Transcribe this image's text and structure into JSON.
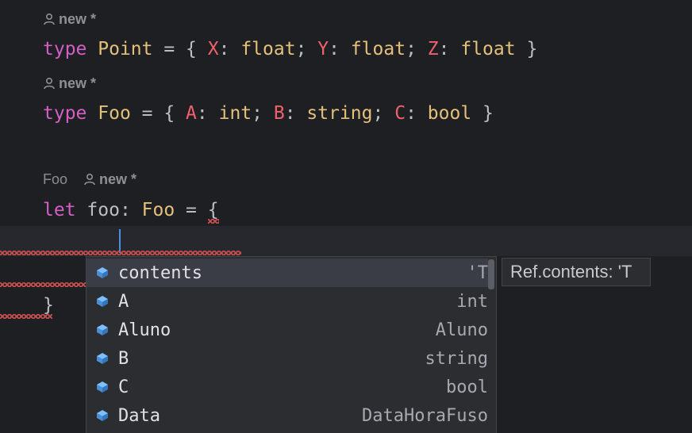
{
  "hints": [
    {
      "author": "new *"
    },
    {
      "author": "new *"
    },
    {
      "type": "Foo",
      "author": "new *"
    }
  ],
  "code": {
    "line1": {
      "kw": "type",
      "name": "Point",
      "f1": "X",
      "t1": "float",
      "f2": "Y",
      "t2": "float",
      "f3": "Z",
      "t3": "float"
    },
    "line2": {
      "kw": "type",
      "name": "Foo",
      "f1": "A",
      "t1": "int",
      "f2": "B",
      "t2": "string",
      "f3": "C",
      "t3": "bool"
    },
    "line3": {
      "kw": "let",
      "ident": "foo",
      "type": "Foo",
      "brace": "{"
    },
    "close_brace": "}"
  },
  "completion": {
    "items": [
      {
        "name": "contents",
        "tail": "'T",
        "selected": true
      },
      {
        "name": "A",
        "tail": "int"
      },
      {
        "name": "Aluno",
        "tail": "Aluno"
      },
      {
        "name": "B",
        "tail": "string"
      },
      {
        "name": "C",
        "tail": "bool"
      },
      {
        "name": "Data",
        "tail": "DataHoraFuso"
      }
    ],
    "icon": "field-cube-icon",
    "icon_color": "#5aa9f0"
  },
  "tooltip": {
    "text": "Ref.contents: 'T"
  },
  "colors": {
    "background": "#1e1f22",
    "keyword": "#d45fc6",
    "type": "#e5c07b",
    "field": "#f0616b",
    "caret": "#4a90e2"
  }
}
